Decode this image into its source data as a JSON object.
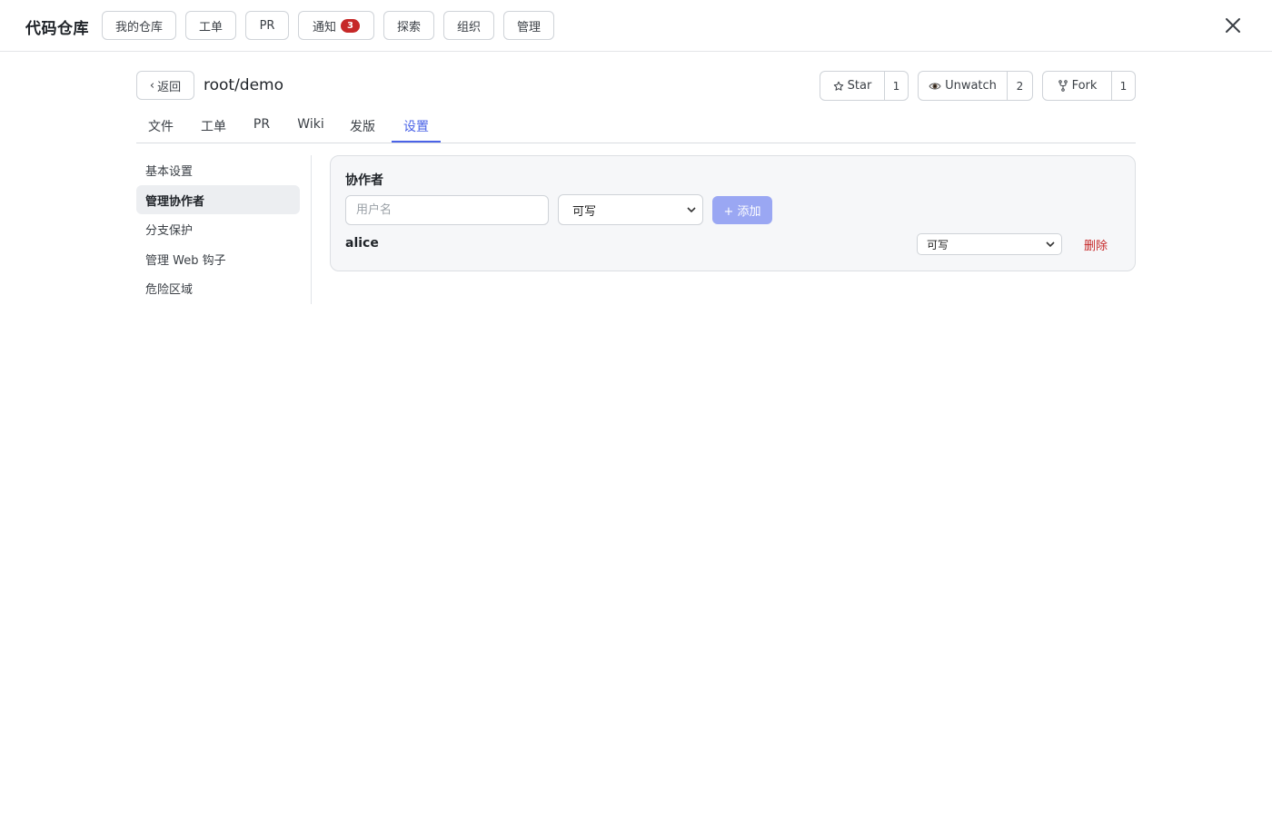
{
  "topbar": {
    "brand": "代码仓库",
    "nav": [
      {
        "label": "我的仓库"
      },
      {
        "label": "工单"
      },
      {
        "label": "PR"
      },
      {
        "label": "通知",
        "badge": "3"
      },
      {
        "label": "探索"
      },
      {
        "label": "组织"
      },
      {
        "label": "管理"
      }
    ],
    "close_icon": "close-icon"
  },
  "repo": {
    "back_label": "返回",
    "title": "root/demo",
    "star": {
      "label": "Star",
      "count": "1",
      "icon": "star-icon"
    },
    "watch": {
      "label": "Unwatch",
      "count": "2",
      "icon": "eye-icon"
    },
    "fork": {
      "label": "Fork",
      "count": "1",
      "icon": "fork-icon"
    }
  },
  "tabs": [
    {
      "label": "文件"
    },
    {
      "label": "工单"
    },
    {
      "label": "PR"
    },
    {
      "label": "Wiki"
    },
    {
      "label": "发版"
    },
    {
      "label": "设置",
      "active": true
    }
  ],
  "sidenav": [
    {
      "label": "基本设置"
    },
    {
      "label": "管理协作者",
      "active": true
    },
    {
      "label": "分支保护"
    },
    {
      "label": "管理 Web 钩子"
    },
    {
      "label": "危险区域"
    }
  ],
  "collaborators": {
    "title": "协作者",
    "username_placeholder": "用户名",
    "permission_value": "可写",
    "add_label": "+ 添加",
    "list": [
      {
        "name": "alice",
        "permission": "可写",
        "delete_label": "删除"
      }
    ]
  },
  "colors": {
    "accent": "#4a63e7",
    "add_button": "#9aa7f3",
    "danger": "#c62828",
    "badge": "#c62828"
  }
}
